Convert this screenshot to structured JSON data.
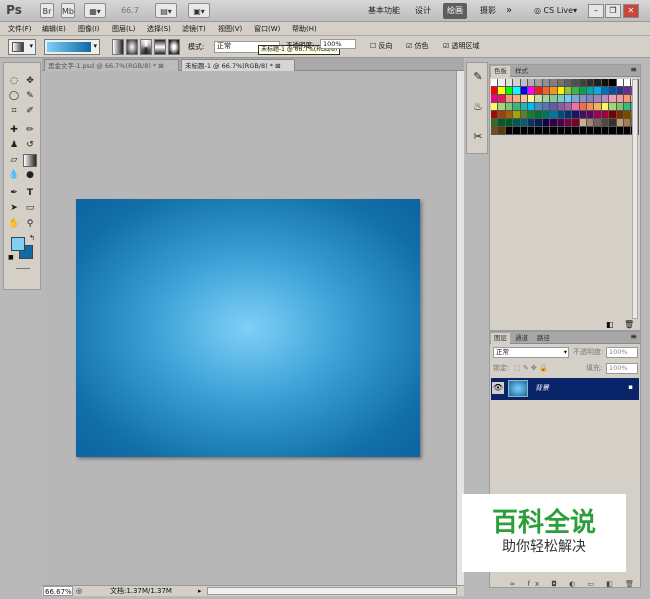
{
  "titlebar": {
    "logo": "Ps",
    "br": "Br",
    "mb": "Mb",
    "zoom": "66.7",
    "workspaces": [
      "基本功能",
      "设计",
      "绘画",
      "摄影"
    ],
    "more": "»",
    "cslive": "CS Live"
  },
  "menu": [
    "文件(F)",
    "编辑(E)",
    "图像(I)",
    "图层(L)",
    "选择(S)",
    "滤镜(T)",
    "视图(V)",
    "窗口(W)",
    "帮助(H)"
  ],
  "options": {
    "mode_label": "模式:",
    "mode_value": "正常",
    "tooltip": "未标题-1 @ 66.7%(RGB/8)",
    "opacity_label": "不透明度:",
    "opacity_value": "100%",
    "reverse": "反向",
    "dither": "仿色",
    "transparency": "透明区域"
  },
  "tabs": [
    {
      "label": "黑金文字-1.psd @ 66.7%(RGB/8) *"
    },
    {
      "label": "未标题-1 @ 66.7%(RGB/8) *"
    }
  ],
  "status": {
    "zoom": "66.67%",
    "doc": "文档:1.37M/1.37M"
  },
  "swatches": {
    "tabs": [
      "色板",
      "样式"
    ],
    "colors": [
      "#ffffff",
      "#f0f0f0",
      "#e0e0e0",
      "#d0d0d0",
      "#c0c0c0",
      "#b0b0b0",
      "#a0a0a0",
      "#909090",
      "#808080",
      "#707070",
      "#606060",
      "#505050",
      "#404040",
      "#303030",
      "#202020",
      "#101010",
      "#000000",
      "#ffffff",
      "#ffffff",
      "#ffffff",
      "#ff0000",
      "#ffff00",
      "#00ff00",
      "#00ffff",
      "#0000ff",
      "#ff00ff",
      "#ee1d24",
      "#f26522",
      "#f7941d",
      "#fff200",
      "#8dc63f",
      "#39b54a",
      "#00a651",
      "#00a99d",
      "#00aeef",
      "#0072bc",
      "#0054a6",
      "#2e3192",
      "#662d91",
      "#92278f",
      "#ec008c",
      "#ed145b",
      "#f69679",
      "#f9ad81",
      "#fdc689",
      "#fff799",
      "#c4df9b",
      "#a3d39c",
      "#82ca9c",
      "#7accc8",
      "#6dcff6",
      "#7da7d9",
      "#8393ca",
      "#8781bd",
      "#a186be",
      "#bd8cbf",
      "#f49ac1",
      "#f5989d",
      "#f7977a",
      "#fbaf5d",
      "#fff568",
      "#acd373",
      "#7cc576",
      "#3bb878",
      "#1abbb4",
      "#00bff3",
      "#438cca",
      "#5574b9",
      "#605ca8",
      "#855fa8",
      "#a763a8",
      "#f06eaa",
      "#f26c4f",
      "#f68e56",
      "#fbaf5d",
      "#fff467",
      "#acd372",
      "#7cc576",
      "#3cb879",
      "#1bbbb4",
      "#9e0b0f",
      "#a0410d",
      "#a36209",
      "#aba000",
      "#598527",
      "#197b30",
      "#007236",
      "#00746b",
      "#0076a3",
      "#004b80",
      "#003471",
      "#1b1464",
      "#440e62",
      "#630460",
      "#9e005d",
      "#9e0039",
      "#790000",
      "#7b2e00",
      "#7d4900",
      "#827b00",
      "#406618",
      "#005e20",
      "#005826",
      "#005952",
      "#005b7f",
      "#003663",
      "#002157",
      "#0d004c",
      "#32004b",
      "#4b0049",
      "#7b0046",
      "#7a0026",
      "#c7b299",
      "#998675",
      "#736357",
      "#534741",
      "#37302a",
      "#c69c6d",
      "#a67c52",
      "#8c6239",
      "#754c24",
      "#603913",
      "#000000",
      "#000000",
      "#000000",
      "#000000",
      "#000000",
      "#000000",
      "#000000",
      "#000000",
      "#000000",
      "#000000",
      "#000000",
      "#000000",
      "#000000",
      "#000000",
      "#000000",
      "#000000",
      "#000000",
      "#000000"
    ]
  },
  "layers": {
    "tabs": [
      "图层",
      "通道",
      "路径"
    ],
    "blend": "正常",
    "opacity_label": "不透明度:",
    "opacity_value": "100%",
    "lock_label": "锁定:",
    "fill_label": "填充:",
    "fill_value": "100%",
    "layer_name": "背景"
  },
  "watermark": {
    "title": "百科全说",
    "subtitle": "助你轻松解决"
  }
}
